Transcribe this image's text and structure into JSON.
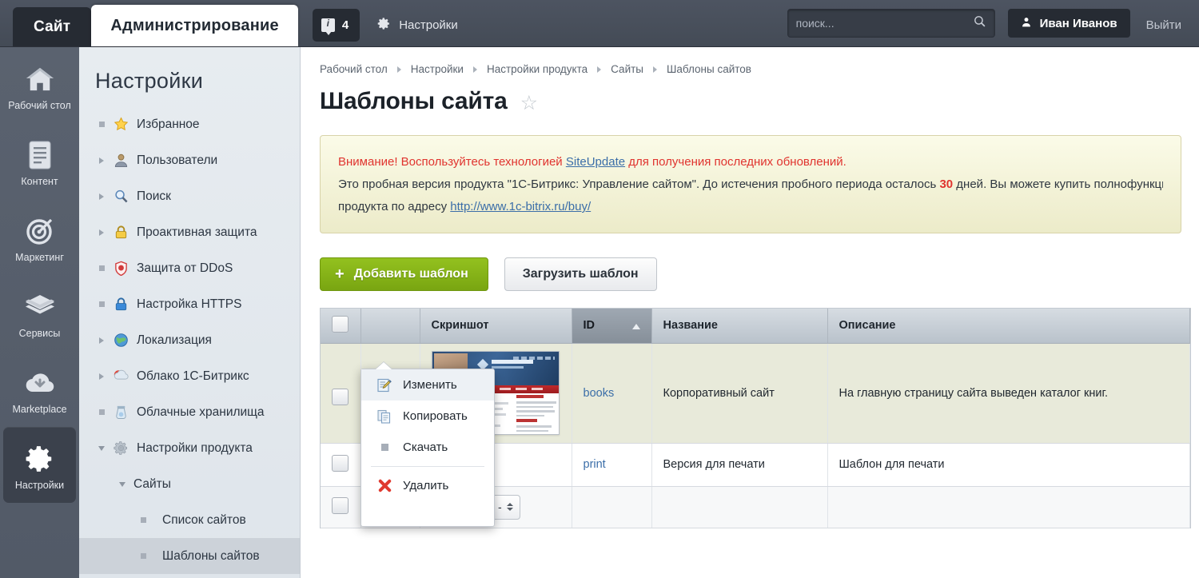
{
  "header": {
    "tab_site": "Сайт",
    "tab_admin": "Администрирование",
    "notifications_count": "4",
    "notifications_icon": "info-badge-icon",
    "settings_label": "Настройки",
    "settings_icon": "gear-icon",
    "search_placeholder": "поиск...",
    "search_value": "",
    "search_icon": "search-icon",
    "user_name": "Иван Иванов",
    "user_icon": "person-icon",
    "logout_label": "Выйти"
  },
  "rail": {
    "items": [
      {
        "label": "Рабочий стол",
        "icon": "home-icon",
        "active": false
      },
      {
        "label": "Контент",
        "icon": "document-icon",
        "active": false
      },
      {
        "label": "Маркетинг",
        "icon": "target-icon",
        "active": false
      },
      {
        "label": "Сервисы",
        "icon": "layers-icon",
        "active": false
      },
      {
        "label": "Marketplace",
        "icon": "cloud-download-icon",
        "active": false
      },
      {
        "label": "Настройки",
        "icon": "gear-icon",
        "active": true
      }
    ]
  },
  "sidebar": {
    "title": "Настройки",
    "items": [
      {
        "label": "Избранное",
        "icon": "star-icon",
        "marker": "square",
        "level": 1
      },
      {
        "label": "Пользователи",
        "icon": "user-icon",
        "marker": "triangle-right",
        "level": 1
      },
      {
        "label": "Поиск",
        "icon": "magnifier-icon",
        "marker": "triangle-right",
        "level": 1
      },
      {
        "label": "Проактивная защита",
        "icon": "lock-yellow-icon",
        "marker": "triangle-right",
        "level": 1
      },
      {
        "label": "Защита от DDoS",
        "icon": "shield-icon",
        "marker": "square",
        "level": 1
      },
      {
        "label": "Настройка HTTPS",
        "icon": "lock-blue-icon",
        "marker": "square",
        "level": 1
      },
      {
        "label": "Локализация",
        "icon": "globe-icon",
        "marker": "triangle-right",
        "level": 1
      },
      {
        "label": "Облако 1С-Битрикс",
        "icon": "cloud-bitrix-icon",
        "marker": "triangle-right",
        "level": 1
      },
      {
        "label": "Облачные хранилища",
        "icon": "cloud-storage-icon",
        "marker": "square",
        "level": 1
      },
      {
        "label": "Настройки продукта",
        "icon": "gear-gray-icon",
        "marker": "triangle-down",
        "level": 1
      },
      {
        "label": "Сайты",
        "icon": "none",
        "marker": "triangle-down",
        "level": 2
      },
      {
        "label": "Список сайтов",
        "icon": "none",
        "marker": "square",
        "level": 3
      },
      {
        "label": "Шаблоны сайтов",
        "icon": "none",
        "marker": "square",
        "level": 3,
        "selected": true
      }
    ]
  },
  "breadcrumbs": [
    "Рабочий стол",
    "Настройки",
    "Настройки продукта",
    "Сайты",
    "Шаблоны сайтов"
  ],
  "page": {
    "title": "Шаблоны сайта",
    "favorite_icon": "star-outline-icon"
  },
  "banner": {
    "line1_warn": "Внимание!",
    "line1_a": " Воспользуйтесь технологией ",
    "line1_link": "SiteUpdate",
    "line1_b": " для получения последних обновлений.",
    "line2_a": "Это пробная версия продукта \"1С-Битрикс: Управление сайтом\". До истечения пробного периода осталось ",
    "line2_days": "30",
    "line2_b": " дней. Вы можете купить полнофункциональную версию",
    "line3_a": "продукта по адресу ",
    "line3_link": "http://www.1c-bitrix.ru/buy/"
  },
  "toolbar": {
    "add_label": "Добавить шаблон",
    "add_plus": "+",
    "upload_label": "Загрузить шаблон"
  },
  "table": {
    "columns": [
      "Скриншот",
      "ID",
      "Название",
      "Описание"
    ],
    "sorted_column": "ID",
    "sort_direction": "asc",
    "rows": [
      {
        "id": "books",
        "name": "Корпоративный сайт",
        "description": "На главную страницу сайта выведен каталог книг.",
        "screenshot_icon": "site-thumbnail"
      },
      {
        "id": "print",
        "name": "Версия для печати",
        "description": "Шаблон для печати",
        "screenshot_icon": "none"
      }
    ],
    "actions_select": "- действия -"
  },
  "context_menu": {
    "items": [
      {
        "label": "Изменить",
        "icon": "edit-pencil-icon",
        "highlighted": true
      },
      {
        "label": "Копировать",
        "icon": "copy-icon",
        "highlighted": false
      },
      {
        "label": "Скачать",
        "icon": "square-gray-icon",
        "highlighted": false
      },
      {
        "label": "Удалить",
        "icon": "delete-cross-icon",
        "highlighted": false,
        "after_divider": true
      }
    ]
  },
  "colors": {
    "accent_green": "#85b318",
    "link_blue": "#3b6ea8",
    "warn_red": "#e0342f",
    "header_dark": "#484f5b",
    "banner_bg": "#f1f0d6"
  }
}
